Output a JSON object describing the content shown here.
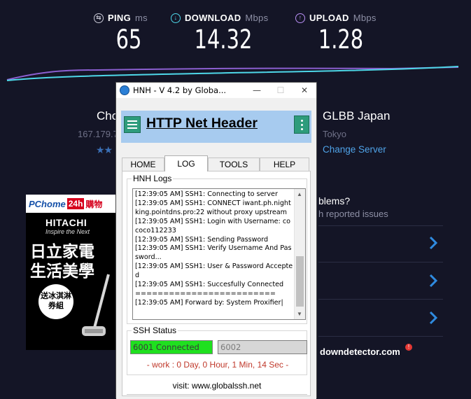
{
  "speedtest": {
    "ping": {
      "label": "PING",
      "unit": "ms",
      "value": "65"
    },
    "download": {
      "label": "DOWNLOAD",
      "unit": "Mbps",
      "value": "14.32"
    },
    "upload": {
      "label": "UPLOAD",
      "unit": "Mbps",
      "value": "1.28"
    },
    "host_name_partial": "Cho",
    "host_ip_partial": "167.179.7",
    "stars": "★★",
    "server_name": "GLBB Japan",
    "server_city": "Tokyo",
    "change_server": "Change Server",
    "problems_title": "blems?",
    "problems_sub": "h reported issues",
    "downdetector": "downdetector.com",
    "downdetector_badge": "!"
  },
  "ad": {
    "brand": "PChome",
    "badge_24": "24h",
    "shop": "購物",
    "maker": "HITACHI",
    "tagline": "Inspire the Next",
    "headline_1": "日立家電",
    "headline_2": "生活美學",
    "promo_1": "送冰淇淋",
    "promo_2": "券組"
  },
  "window": {
    "title": "HNH - V 4.2 by Globa...",
    "minimize": "—",
    "maximize": "☐",
    "close": "✕",
    "header_title": "HTTP Net Header",
    "tabs": [
      {
        "label": "HOME",
        "active": false
      },
      {
        "label": "LOG",
        "active": true
      },
      {
        "label": "TOOLS",
        "active": false
      },
      {
        "label": "HELP",
        "active": false
      }
    ],
    "logs_label": "HNH Logs",
    "log_text": "[12:39:05 AM] SSH1: Connecting to server\n[12:39:05 AM] SSH1: CONNECT iwant.ph.nightking.pointdns.pro:22 without proxy upstream\n[12:39:05 AM] SSH1: Login with Username: cococo112233\n[12:39:05 AM] SSH1: Sending Password\n[12:39:05 AM] SSH1: Verify Username And Password...\n[12:39:05 AM] SSH1: User & Password Accepted\n[12:39:05 AM] SSH1: Succesfully Connected\n=========================\n[12:39:05 AM] Forward by: System Proxifier|",
    "ssh_label": "SSH Status",
    "ssh_slot_1": "6001  Connected",
    "ssh_slot_2": "6002",
    "work_text": "- work : 0 Day, 0 Hour, 1 Min, 14 Sec -",
    "visit_text": "visit: www.globalssh.net"
  },
  "colors": {
    "background": "#141526",
    "download_accent": "#4ed7e8",
    "upload_accent": "#b98ff5",
    "link": "#4fa3e8",
    "header_band": "#a7cbef",
    "header_buttons": "#2e9c7c",
    "connected": "#1fe01f",
    "work_text": "#c0392b"
  }
}
